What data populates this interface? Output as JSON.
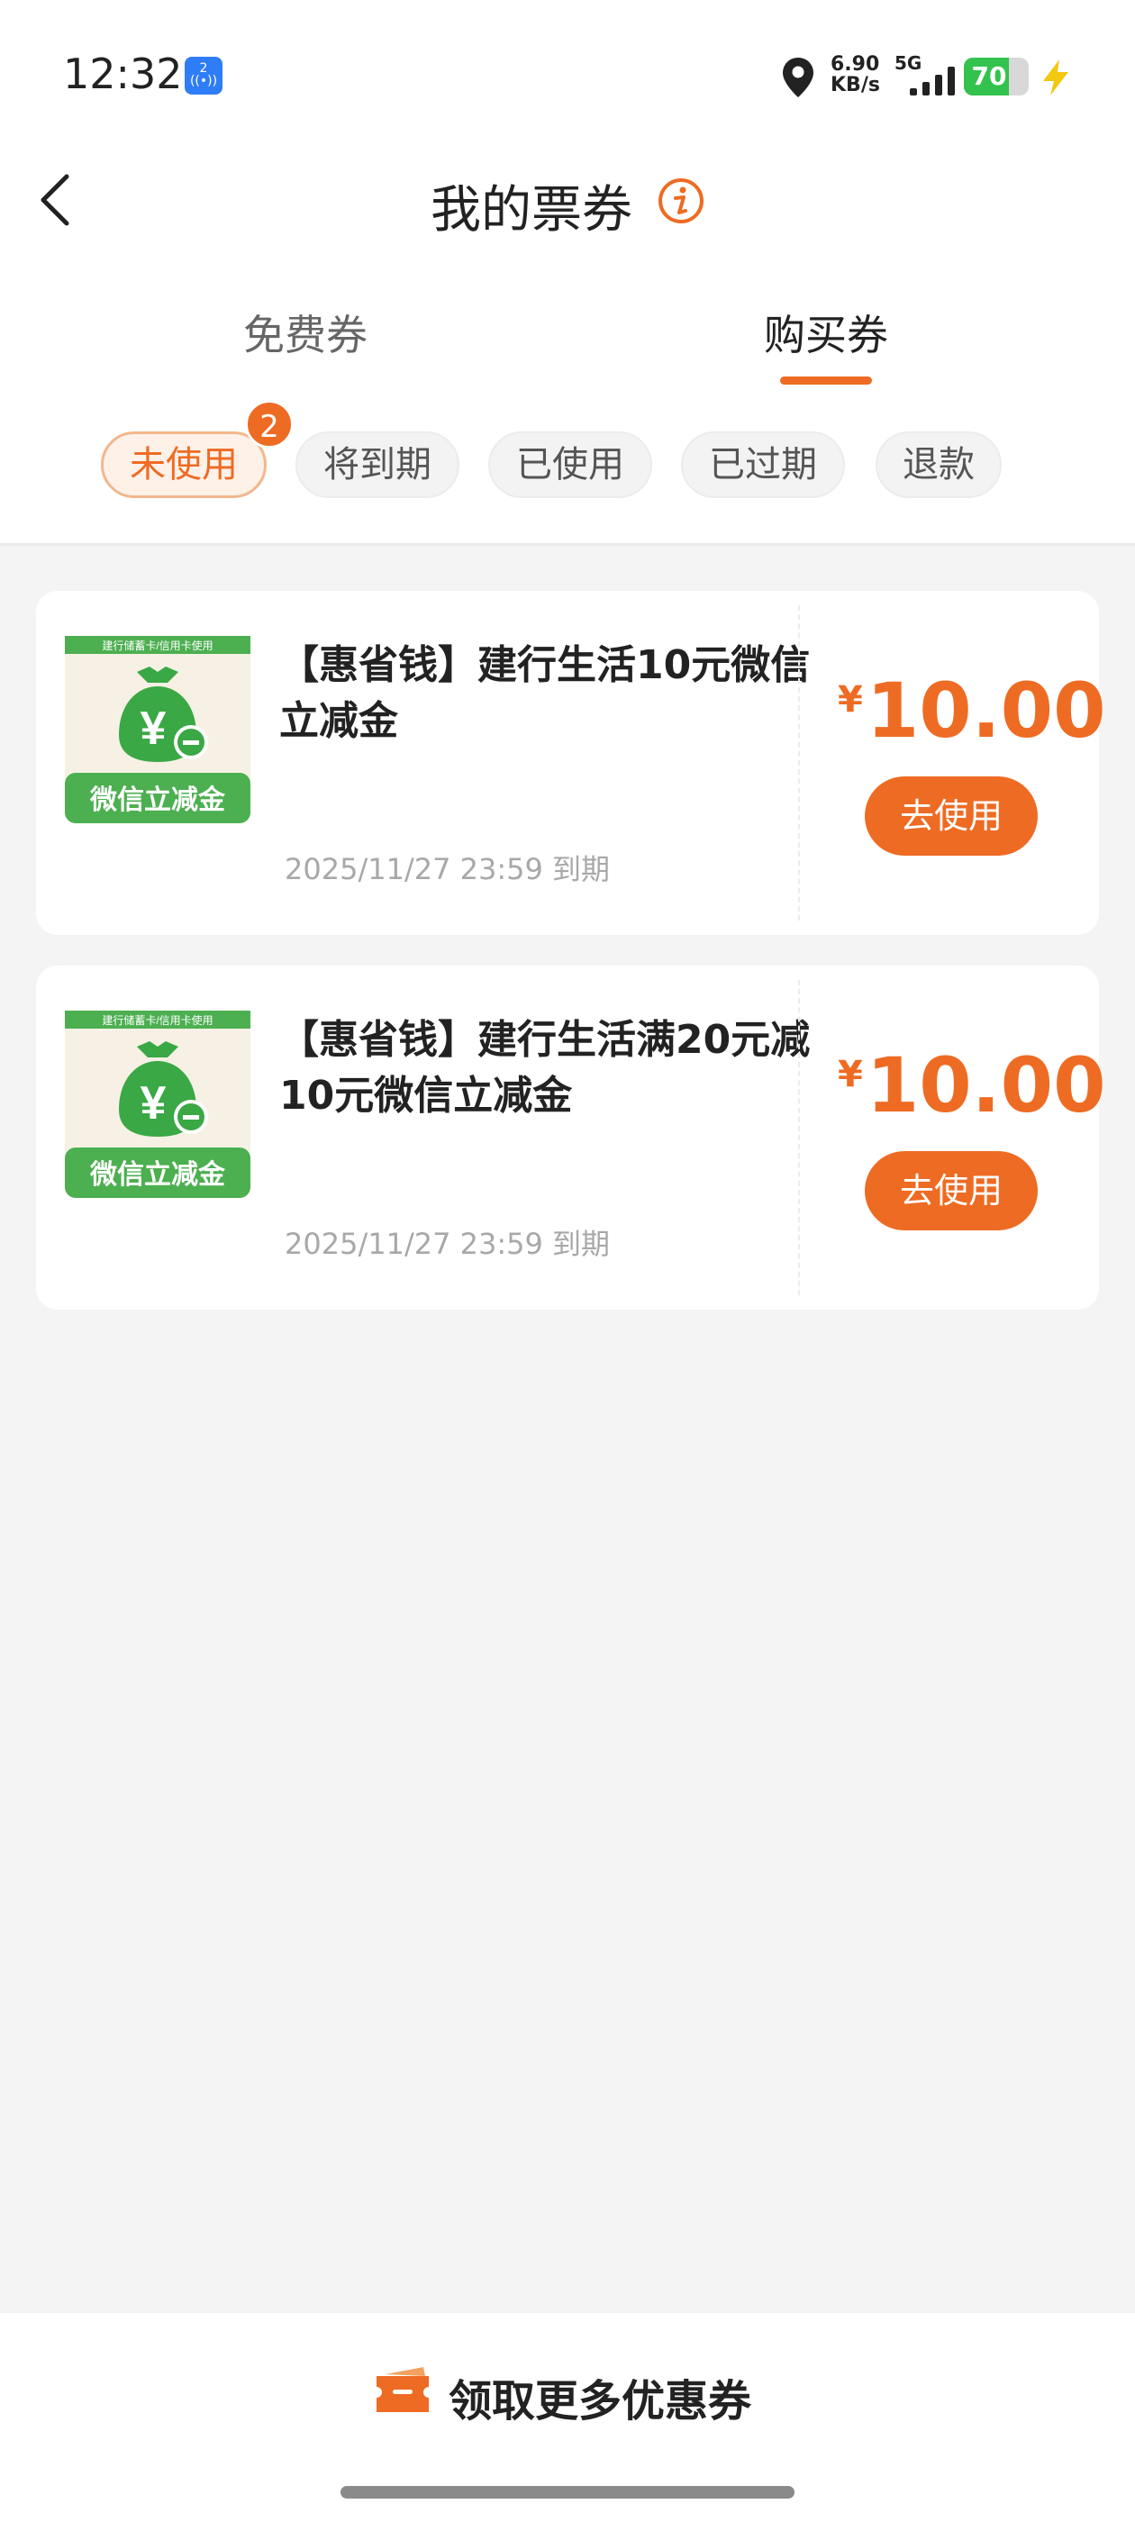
{
  "status_bar": {
    "time": "12:32",
    "nfc_badge": "2",
    "speed_value": "6.90",
    "speed_unit": "KB/s",
    "network": "5G",
    "battery": "70",
    "battery_level": 0.7,
    "icons": [
      "nfc-icon",
      "location-icon",
      "signal-icon",
      "battery-icon",
      "charging-bolt-icon"
    ]
  },
  "header": {
    "title": "我的票券",
    "back_icon": "chevron-left-icon",
    "info_icon": "info-icon"
  },
  "tabs": [
    {
      "label": "免费券",
      "active": false
    },
    {
      "label": "购买券",
      "active": true
    }
  ],
  "filters": [
    {
      "label": "未使用",
      "active": true,
      "badge": "2"
    },
    {
      "label": "将到期",
      "active": false
    },
    {
      "label": "已使用",
      "active": false
    },
    {
      "label": "已过期",
      "active": false
    },
    {
      "label": "退款",
      "active": false
    }
  ],
  "coupons": [
    {
      "title": "【惠省钱】建行生活10元微信立减金",
      "thumb_top_text": "建行储蓄卡/信用卡使用",
      "thumb_label": "微信立减金",
      "expiry": "2025/11/27 23:59 到期",
      "currency": "¥",
      "price": "10.00",
      "action": "去使用"
    },
    {
      "title": "【惠省钱】建行生活满20元减10元微信立减金",
      "thumb_top_text": "建行储蓄卡/信用卡使用",
      "thumb_label": "微信立减金",
      "expiry": "2025/11/27 23:59 到期",
      "currency": "¥",
      "price": "10.00",
      "action": "去使用"
    }
  ],
  "bottom": {
    "label": "领取更多优惠券",
    "icon": "ticket-icon"
  },
  "colors": {
    "accent": "#ee6b23",
    "background": "#f4f4f4",
    "card": "#ffffff",
    "thumb_green": "#4caf50"
  }
}
